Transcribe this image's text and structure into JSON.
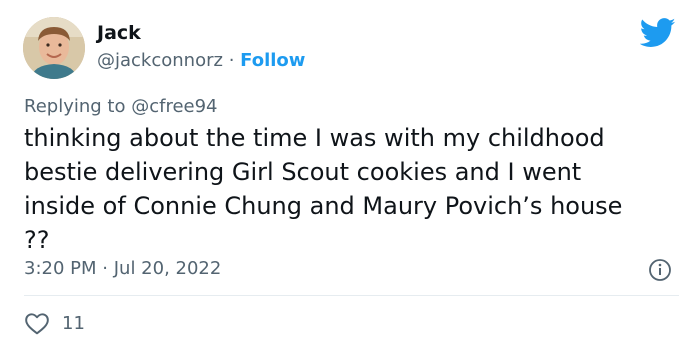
{
  "user": {
    "name": "Jack",
    "handle": "@jackconnorz",
    "separator": "·",
    "follow_label": "Follow"
  },
  "reply": {
    "prefix": "Replying to",
    "to": "@cfree94"
  },
  "tweet": {
    "lines": [
      "thinking about the time I was with my childhood",
      "bestie delivering Girl Scout cookies and I went",
      "inside of Connie Chung and Maury Povich’s house",
      "??"
    ]
  },
  "meta": {
    "time": "3:20 PM",
    "separator": "·",
    "date": "Jul 20, 2022"
  },
  "engagement": {
    "likes": "11"
  },
  "icons": {
    "logo": "twitter-bird-icon",
    "info": "info-icon",
    "like": "heart-icon"
  },
  "colors": {
    "brand": "#1d9bf0",
    "text": "#0f1419",
    "muted": "#536471"
  }
}
